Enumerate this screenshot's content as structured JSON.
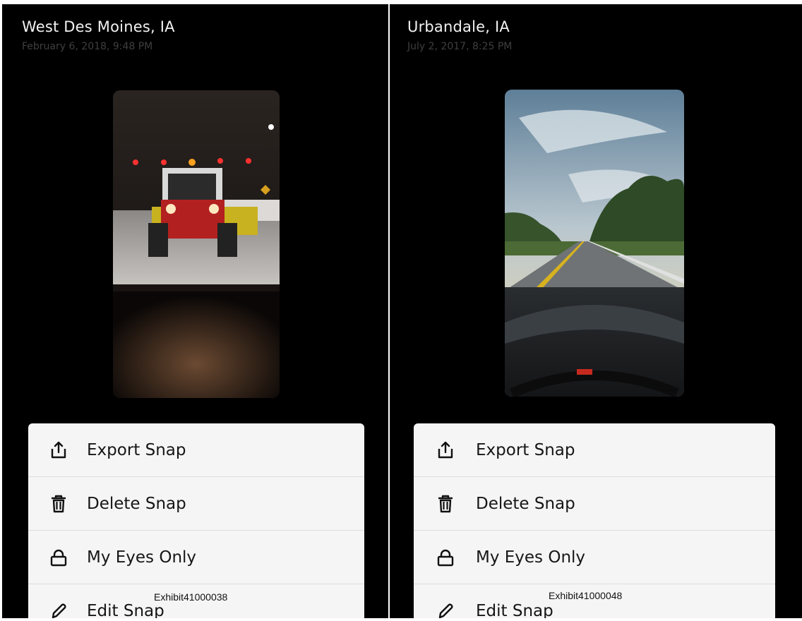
{
  "panels": [
    {
      "location": "West Des Moines, IA",
      "date": "February 6, 2018, 9:48 PM"
    },
    {
      "location": "Urbandale, IA",
      "date": "July 2, 2017, 8:25 PM"
    }
  ],
  "menu": {
    "export_label": "Export Snap",
    "delete_label": "Delete Snap",
    "eyes_label": "My Eyes Only",
    "edit_label": "Edit Snap"
  },
  "exhibits": {
    "left": "Exhibit41000038",
    "right": "Exhibit41000048"
  },
  "icons": {
    "export": "export-icon",
    "delete": "trash-icon",
    "eyes": "lock-icon",
    "edit": "pencil-icon"
  },
  "colors": {
    "panel_bg": "#000000",
    "menu_bg": "#f5f5f5",
    "title_text": "#f2f2f2",
    "date_text": "#3f3f3f"
  }
}
